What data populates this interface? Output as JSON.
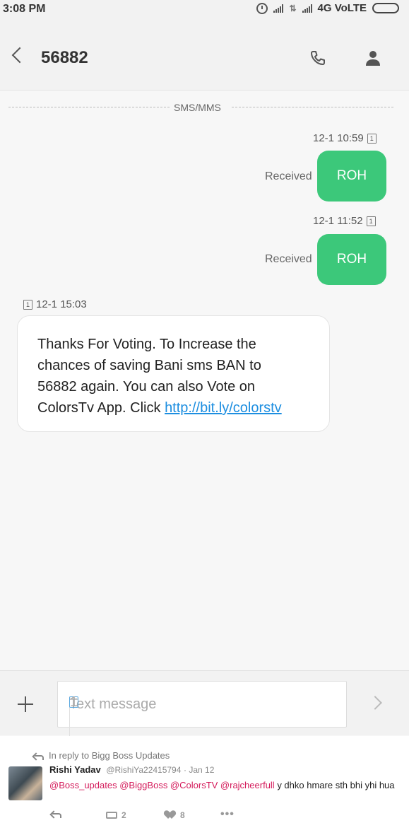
{
  "status_bar": {
    "time": "3:08 PM",
    "network": "4G VoLTE"
  },
  "header": {
    "title": "56882",
    "icons": [
      "back-icon",
      "phone-icon",
      "contact-icon"
    ]
  },
  "divider_label": "SMS/MMS",
  "messages": [
    {
      "timestamp": "12-1 10:59",
      "sim": "1",
      "status": "Received",
      "text": "ROH"
    },
    {
      "timestamp": "12-1 11:52",
      "sim": "1",
      "status": "Received",
      "text": "ROH"
    }
  ],
  "incoming": {
    "sim": "1",
    "timestamp": "12-1 15:03",
    "line1": "Thanks For Voting. To Increase the",
    "line2": "chances of saving Bani sms BAN to",
    "line3": "56882 again. You can also Vote on",
    "line4_prefix": "ColorsTv App. Click ",
    "link": "http://bit.ly/colorstv"
  },
  "composer": {
    "placeholder": "Text message",
    "sim": "1"
  },
  "tweet": {
    "reply_context": "In reply to Bigg Boss Updates",
    "name": "Rishi Yadav",
    "handle": "@RishiYa22415794",
    "date": "· Jan 12",
    "mentions": "@Boss_updates @BiggBoss @ColorsTV @rajcheerfull",
    "text": " y dhko hmare sth bhi yhi hua",
    "retweets": "2",
    "likes": "8"
  },
  "colors": {
    "outgoing_bubble": "#3cc87a",
    "link": "#1d8ee0",
    "mention": "#d41b5b"
  }
}
